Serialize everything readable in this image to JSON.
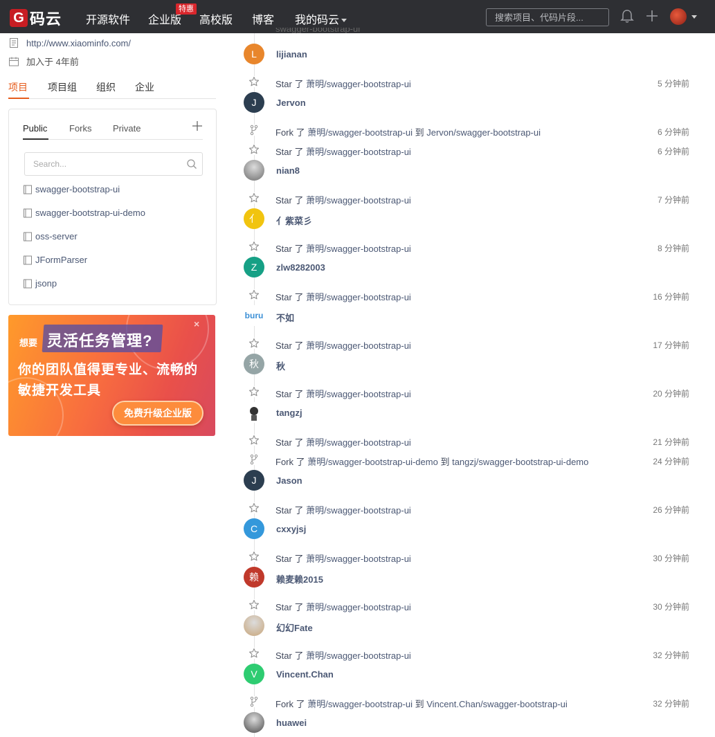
{
  "nav": {
    "logo_mark": "G",
    "logo_text": "码云",
    "items": [
      "开源软件",
      "企业版",
      "高校版",
      "博客",
      "我的码云"
    ],
    "badge": "特惠",
    "search_placeholder": "搜索项目、代码片段..."
  },
  "profile": {
    "website": "http://www.xiaominfo.com/",
    "joined": "加入于 4年前"
  },
  "main_tabs": [
    "项目",
    "项目组",
    "组织",
    "企业"
  ],
  "project_tabs": [
    "Public",
    "Forks",
    "Private"
  ],
  "project_search_placeholder": "Search...",
  "projects": [
    "swagger-bootstrap-ui",
    "swagger-bootstrap-ui-demo",
    "oss-server",
    "JFormParser",
    "jsonp"
  ],
  "ad": {
    "small": "想要",
    "headline": "灵活任务管理?",
    "line1": "你的团队值得更专业、流畅的",
    "line2": "敏捷开发工具",
    "button": "免费升级企业版"
  },
  "feed": {
    "verb_star": "Star 了",
    "verb_fork": "Fork 了",
    "to": "到",
    "events": [
      {
        "user": "lijianan",
        "avatar": "L",
        "color": "#e8862c",
        "actions": [
          {
            "type": "star",
            "repo": "萧明/swagger-bootstrap-ui",
            "time": "5 分钟前"
          }
        ]
      },
      {
        "user": "Jervon",
        "avatar": "J",
        "color": "#2c3e50",
        "actions": [
          {
            "type": "fork",
            "repo": "萧明/swagger-bootstrap-ui",
            "target": "Jervon/swagger-bootstrap-ui",
            "time": "6 分钟前"
          },
          {
            "type": "star",
            "repo": "萧明/swagger-bootstrap-ui",
            "time": "6 分钟前"
          }
        ]
      },
      {
        "user": "nian8",
        "avatar": "",
        "color": "#6e6e6e",
        "actions": [
          {
            "type": "star",
            "repo": "萧明/swagger-bootstrap-ui",
            "time": "7 分钟前"
          }
        ]
      },
      {
        "user": "亻紫菜彡",
        "avatar": "亻",
        "color": "#f1c40f",
        "actions": [
          {
            "type": "star",
            "repo": "萧明/swagger-bootstrap-ui",
            "time": "8 分钟前"
          }
        ]
      },
      {
        "user": "zlw8282003",
        "avatar": "Z",
        "color": "#16a085",
        "actions": [
          {
            "type": "star",
            "repo": "萧明/swagger-bootstrap-ui",
            "time": "16 分钟前"
          }
        ]
      },
      {
        "user": "不如",
        "avatar": "buru",
        "color": "#ffffff",
        "actions": [
          {
            "type": "star",
            "repo": "萧明/swagger-bootstrap-ui",
            "time": "17 分钟前"
          }
        ]
      },
      {
        "user": "秋",
        "avatar": "秋",
        "color": "#95a5a6",
        "actions": [
          {
            "type": "star",
            "repo": "萧明/swagger-bootstrap-ui",
            "time": "20 分钟前"
          }
        ]
      },
      {
        "user": "tangzj",
        "avatar": "",
        "color": "#ffffff",
        "actions": [
          {
            "type": "star",
            "repo": "萧明/swagger-bootstrap-ui",
            "time": "21 分钟前"
          },
          {
            "type": "fork",
            "repo": "萧明/swagger-bootstrap-ui-demo",
            "target": "tangzj/swagger-bootstrap-ui-demo",
            "time": "24 分钟前"
          }
        ]
      },
      {
        "user": "Jason",
        "avatar": "J",
        "color": "#2c3e50",
        "actions": [
          {
            "type": "star",
            "repo": "萧明/swagger-bootstrap-ui",
            "time": "26 分钟前"
          }
        ]
      },
      {
        "user": "cxxyjsj",
        "avatar": "C",
        "color": "#3498db",
        "actions": [
          {
            "type": "star",
            "repo": "萧明/swagger-bootstrap-ui",
            "time": "30 分钟前"
          }
        ]
      },
      {
        "user": "赖麦赖2015",
        "avatar": "赖",
        "color": "#c0392b",
        "actions": [
          {
            "type": "star",
            "repo": "萧明/swagger-bootstrap-ui",
            "time": "30 分钟前"
          }
        ]
      },
      {
        "user": "幻幻Fate",
        "avatar": "",
        "color": "#c8a57a",
        "actions": [
          {
            "type": "star",
            "repo": "萧明/swagger-bootstrap-ui",
            "time": "32 分钟前"
          }
        ]
      },
      {
        "user": "Vincent.Chan",
        "avatar": "V",
        "color": "#2ecc71",
        "actions": [
          {
            "type": "fork",
            "repo": "萧明/swagger-bootstrap-ui",
            "target": "Vincent.Chan/swagger-bootstrap-ui",
            "time": "32 分钟前"
          }
        ]
      },
      {
        "user": "huawei",
        "avatar": "",
        "color": "#4a4a4a",
        "actions": []
      }
    ]
  }
}
